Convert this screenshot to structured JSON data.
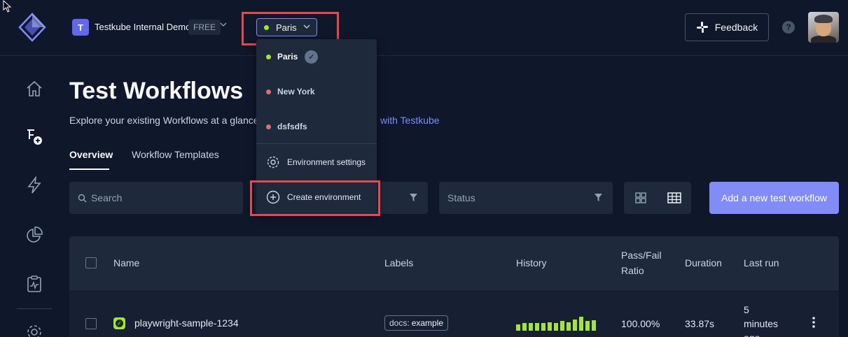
{
  "header": {
    "org_initial": "T",
    "org_name": "Testkube Internal Demo",
    "plan": "FREE",
    "current_environment": "Paris",
    "feedback_label": "Feedback",
    "help_symbol": "?"
  },
  "sidebar": {
    "items": [
      {
        "icon": "home-icon"
      },
      {
        "icon": "test-workflows-icon"
      },
      {
        "icon": "lightning-icon"
      },
      {
        "icon": "pie-chart-icon"
      },
      {
        "icon": "clipboard-pulse-icon"
      },
      {
        "icon": "gear-icon"
      }
    ]
  },
  "environment_dropdown": {
    "environments": [
      {
        "name": "Paris",
        "status_color": "#a3e635",
        "selected": true
      },
      {
        "name": "New York",
        "status_color": "#e06c75",
        "selected": false
      },
      {
        "name": "dsfsdfs",
        "status_color": "#e06c75",
        "selected": false
      }
    ],
    "settings_label": "Environment settings",
    "create_label": "Create environment"
  },
  "main": {
    "title": "Test Workflows",
    "subtitle_start": "Explore your existing Workflows at a glance",
    "subtitle_link": "with Testkube",
    "tabs": [
      {
        "label": "Overview",
        "active": true
      },
      {
        "label": "Workflow Templates",
        "active": false
      }
    ],
    "search_placeholder": "Search",
    "status_placeholder": "Status",
    "add_button": "Add a new test workflow"
  },
  "table": {
    "columns": {
      "name": "Name",
      "labels": "Labels",
      "history": "History",
      "pass_fail_1": "Pass/Fail",
      "pass_fail_2": "Ratio",
      "duration": "Duration",
      "last_run": "Last run"
    },
    "rows": [
      {
        "name": "playwright-sample-1234",
        "label_key": "docs:",
        "label_value": "example",
        "history": [
          9,
          11,
          11,
          11,
          11,
          12,
          11,
          14,
          12,
          16,
          20,
          14,
          15
        ],
        "pass_fail_ratio": "100.00%",
        "duration": "33.87s",
        "last_run_1": "5",
        "last_run_2": "minutes",
        "last_run_3": "ago"
      }
    ]
  },
  "colors": {
    "accent": "#818cf8",
    "success": "#a3e635",
    "error": "#e06c75",
    "highlight_box": "#e5484d"
  }
}
